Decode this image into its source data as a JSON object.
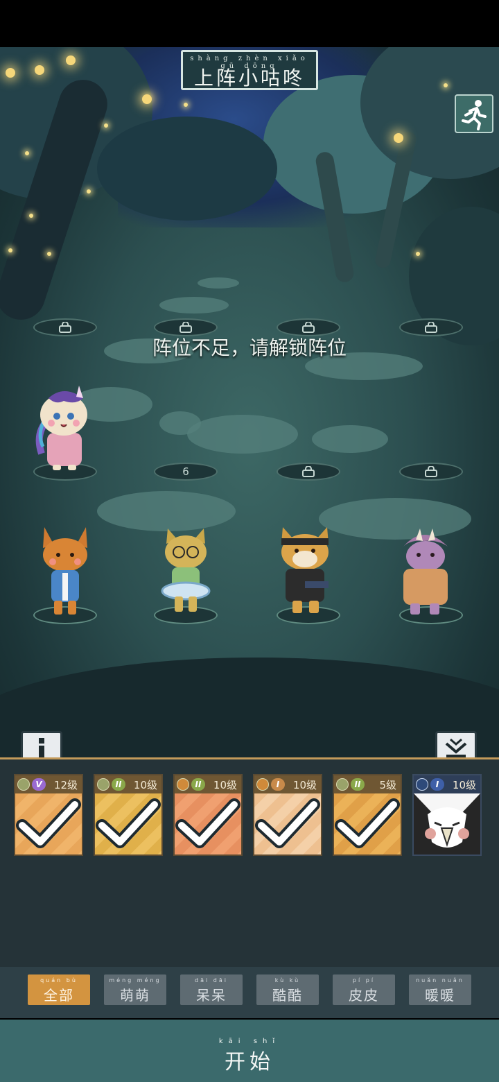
{
  "title": {
    "pinyin": "shàng zhèn xiǎo gū dōng",
    "text": "上阵小咕咚"
  },
  "warning": "阵位不足，请解锁阵位",
  "slots": [
    {
      "label": ""
    },
    {
      "label": ""
    },
    {
      "label": ""
    },
    {
      "label": ""
    },
    {
      "label": ""
    },
    {
      "label": "6"
    },
    {
      "label": ""
    },
    {
      "label": ""
    }
  ],
  "characters": [
    "unicorn-cat",
    "fox",
    "cat-with-glasses",
    "shiba-dog",
    "triceratops"
  ],
  "cards": [
    {
      "grade": "V",
      "grade_color": "#9a6ad0",
      "level": "12级",
      "selected": true
    },
    {
      "grade": "II",
      "grade_color": "#8aa84a",
      "level": "10级",
      "selected": true
    },
    {
      "grade": "II",
      "grade_color": "#8aa84a",
      "level": "10级",
      "selected": true
    },
    {
      "grade": "I",
      "grade_color": "#c88a4a",
      "level": "10级",
      "selected": true
    },
    {
      "grade": "II",
      "grade_color": "#8aa84a",
      "level": "5级",
      "selected": true
    },
    {
      "grade": "I",
      "grade_color": "#3e5fa8",
      "level": "10级",
      "selected": false
    }
  ],
  "tabs": [
    {
      "pinyin": "quán bù",
      "label": "全部",
      "active": true
    },
    {
      "pinyin": "méng méng",
      "label": "萌萌",
      "active": false
    },
    {
      "pinyin": "dāi dāi",
      "label": "呆呆",
      "active": false
    },
    {
      "pinyin": "kù kù",
      "label": "酷酷",
      "active": false
    },
    {
      "pinyin": "pí pí",
      "label": "皮皮",
      "active": false
    },
    {
      "pinyin": "nuǎn nuǎn",
      "label": "暖暖",
      "active": false
    }
  ],
  "start_button": {
    "pinyin": "kāi shǐ",
    "label": "开始"
  },
  "colors": {
    "accent": "#d39440",
    "start": "#3b6a6c",
    "panel": "#253338"
  }
}
